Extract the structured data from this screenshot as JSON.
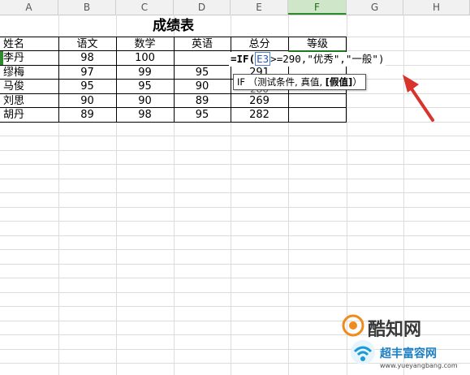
{
  "columns": [
    "A",
    "B",
    "C",
    "D",
    "E",
    "F",
    "G",
    "H"
  ],
  "active_column": "F",
  "title": "成绩表",
  "headers": [
    "姓名",
    "语文",
    "数学",
    "英语",
    "总分",
    "等级"
  ],
  "rows": [
    {
      "name": "李丹",
      "chinese": "98",
      "math": "100",
      "english": "",
      "total": "",
      "grade": ""
    },
    {
      "name": "缪梅",
      "chinese": "97",
      "math": "99",
      "english": "95",
      "total": "291",
      "grade": ""
    },
    {
      "name": "马俊",
      "chinese": "95",
      "math": "95",
      "english": "90",
      "total": "280",
      "grade": ""
    },
    {
      "name": "刘思",
      "chinese": "90",
      "math": "90",
      "english": "89",
      "total": "269",
      "grade": ""
    },
    {
      "name": "胡丹",
      "chinese": "89",
      "math": "98",
      "english": "95",
      "total": "282",
      "grade": ""
    }
  ],
  "formula": {
    "prefix": "=IF(",
    "ref": "E3",
    "suffix": ">=290,\"优秀\",\"一般\")"
  },
  "tooltip": {
    "fn": "IF",
    "args": "（测试条件, 真值,",
    "optional": "[假值]",
    "close": "）"
  },
  "watermark": {
    "logo_text": "酷知网",
    "sub_text": "超丰富容网",
    "url": "www.yueyangbang.com"
  },
  "colors": {
    "active_header": "#cfe6c8",
    "selection": "#1f7a1f",
    "arrow": "#d9342b"
  }
}
